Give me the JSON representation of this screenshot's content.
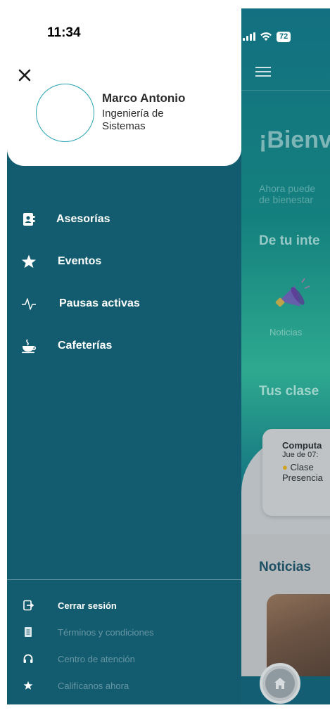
{
  "status_bar": {
    "time": "11:34",
    "battery": "72"
  },
  "drawer": {
    "user": {
      "name": "Marco Antonio",
      "career": "Ingeniería de Sistemas"
    },
    "menu": [
      {
        "label": "Asesorías",
        "icon": "contact-book-icon"
      },
      {
        "label": "Eventos",
        "icon": "star-icon"
      },
      {
        "label": "Pausas activas",
        "icon": "pulse-icon"
      },
      {
        "label": "Cafeterías",
        "icon": "coffee-cup-icon"
      }
    ],
    "footer": [
      {
        "label": "Cerrar sesión",
        "icon": "logout-icon"
      },
      {
        "label": "Términos y condiciones",
        "icon": "document-icon"
      },
      {
        "label": "Centro de atención",
        "icon": "headset-icon"
      },
      {
        "label": "Califícanos ahora",
        "icon": "star-icon"
      }
    ]
  },
  "background": {
    "welcome": "¡Bienv",
    "subtitle": "Ahora puede\nde bienestar",
    "interest_title": "De tu inte",
    "interest_item": "Noticias",
    "classes_title": "Tus clase",
    "class_card": {
      "title": "Computa",
      "time": "Jue de 07:",
      "location": "Clase\nPresencia"
    },
    "news_title": "Noticias"
  },
  "colors": {
    "drawer_bg": "#135c70",
    "accent": "#2aa3b4",
    "header_bg": "#ffffff"
  }
}
